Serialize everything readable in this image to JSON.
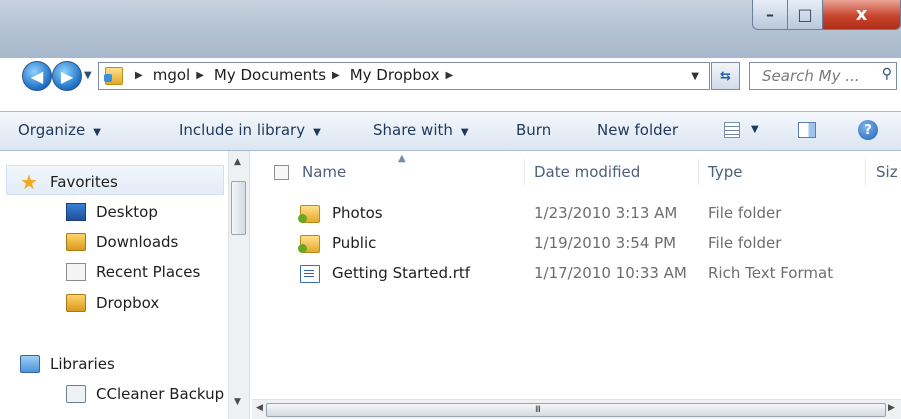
{
  "window": {
    "controls": {
      "minimize": "–",
      "maximize": "□",
      "close": "x"
    }
  },
  "address": {
    "crumbs": [
      "mgol",
      "My Documents",
      "My Dropbox"
    ],
    "search_placeholder": "Search My ..."
  },
  "toolbar": {
    "organize": "Organize",
    "include_in_library": "Include in library",
    "share_with": "Share with",
    "burn": "Burn",
    "new_folder": "New folder",
    "help": "?"
  },
  "nav": {
    "favorites": "Favorites",
    "items": [
      "Desktop",
      "Downloads",
      "Recent Places",
      "Dropbox"
    ],
    "libraries": "Libraries",
    "libraries_items": [
      "CCleaner Backup"
    ]
  },
  "columns": {
    "name": "Name",
    "date_modified": "Date modified",
    "type": "Type",
    "size": "Siz"
  },
  "files": [
    {
      "name": "Photos",
      "date": "1/23/2010 3:13 AM",
      "type": "File folder",
      "icon": "folder-icon"
    },
    {
      "name": "Public",
      "date": "1/19/2010 3:54 PM",
      "type": "File folder",
      "icon": "folder-icon"
    },
    {
      "name": "Getting Started.rtf",
      "date": "1/17/2010 10:33 AM",
      "type": "Rich Text Format",
      "icon": "rtf-document-icon"
    }
  ],
  "scrollbar": {
    "grip": "III"
  }
}
